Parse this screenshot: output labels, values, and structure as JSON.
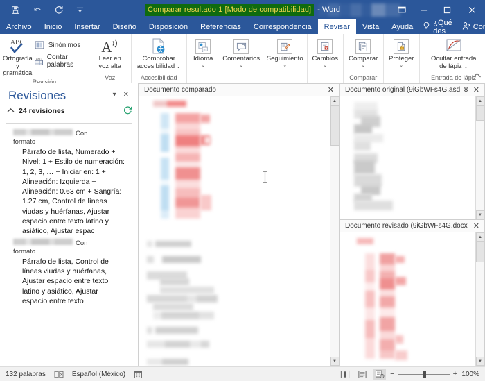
{
  "titlebar": {
    "quick_access": [
      {
        "name": "save-icon",
        "label": "Guardar"
      },
      {
        "name": "undo-icon",
        "label": "Deshacer"
      },
      {
        "name": "redo-icon",
        "label": "Rehacer"
      },
      {
        "name": "customize-qat-icon",
        "label": "Personalizar barra de herramientas de acceso rápido"
      }
    ],
    "doc_title_highlight": "Comparar resultado 1 [Modo de compatibilidad]",
    "doc_title_rest": "- Word",
    "window_controls": [
      {
        "name": "ribbon-display-options-icon",
        "glyph": "⊞"
      },
      {
        "name": "minimize-button",
        "glyph": "—"
      },
      {
        "name": "restore-button",
        "glyph": "❐"
      },
      {
        "name": "close-button",
        "glyph": "✕"
      }
    ]
  },
  "ribbon_tabs": {
    "tabs": [
      {
        "label": "Archivo",
        "active": false
      },
      {
        "label": "Inicio",
        "active": false
      },
      {
        "label": "Insertar",
        "active": false
      },
      {
        "label": "Diseño",
        "active": false
      },
      {
        "label": "Disposición",
        "active": false
      },
      {
        "label": "Referencias",
        "active": false
      },
      {
        "label": "Correspondencia",
        "active": false
      },
      {
        "label": "Revisar",
        "active": true
      },
      {
        "label": "Vista",
        "active": false
      },
      {
        "label": "Ayuda",
        "active": false
      }
    ],
    "tell_me": "¿Qué des",
    "share": "Compartir"
  },
  "ribbon": {
    "groups": [
      {
        "label": "Revisión",
        "big": [
          {
            "label_line1": "Ortografía",
            "label_line2": "y gramática",
            "icon": "spelling-abc-check-icon"
          }
        ],
        "small": [
          {
            "label": "Sinónimos",
            "icon": "thesaurus-icon"
          },
          {
            "label": "Contar palabras",
            "icon": "word-count-icon"
          }
        ]
      },
      {
        "label": "Voz",
        "big": [
          {
            "label_line1": "Leer en",
            "label_line2": "voz alta",
            "icon": "read-aloud-icon"
          }
        ],
        "small": []
      },
      {
        "label": "Accesibilidad",
        "big": [
          {
            "label_line1": "Comprobar",
            "label_line2": "accesibilidad",
            "icon": "check-accessibility-icon",
            "dropdown": true
          }
        ],
        "small": []
      },
      {
        "label": "",
        "big": [
          {
            "label_line1": "Idioma",
            "label_line2": "",
            "icon": "language-icon",
            "dropdown": true
          }
        ],
        "small": []
      },
      {
        "label": "",
        "big": [
          {
            "label_line1": "Comentarios",
            "label_line2": "",
            "icon": "comments-icon",
            "dropdown": true
          }
        ],
        "small": []
      },
      {
        "label": "",
        "big": [
          {
            "label_line1": "Seguimiento",
            "label_line2": "",
            "icon": "track-changes-icon",
            "dropdown": true
          }
        ],
        "small": []
      },
      {
        "label": "",
        "big": [
          {
            "label_line1": "Cambios",
            "label_line2": "",
            "icon": "changes-icon",
            "dropdown": true
          }
        ],
        "small": []
      },
      {
        "label": "Comparar",
        "big": [
          {
            "label_line1": "Comparar",
            "label_line2": "",
            "icon": "compare-icon",
            "dropdown": true
          }
        ],
        "small": []
      },
      {
        "label": "",
        "big": [
          {
            "label_line1": "Proteger",
            "label_line2": "",
            "icon": "protect-icon",
            "dropdown": true
          }
        ],
        "small": []
      },
      {
        "label": "Entrada de lápiz",
        "big": [
          {
            "label_line1": "Ocultar entrada",
            "label_line2": "de lápiz",
            "icon": "hide-ink-icon",
            "dropdown": true
          }
        ],
        "small": []
      }
    ],
    "collapse_label": "^"
  },
  "revisions_pane": {
    "title": "Revisiones",
    "count_label": "24 revisiones",
    "entries": [
      {
        "tag": "Con",
        "tag2": "formato",
        "body": "Párrafo de lista, Numerado + Nivel: 1 + Estilo de numeración: 1, 2, 3, … + Iniciar en: 1 + Alineación: Izquierda + Alineación:  0.63 cm + Sangría:  1.27 cm, Control de líneas viudas y huérfanas, Ajustar espacio entre texto latino y asiático, Ajustar espac"
      },
      {
        "tag": "Con",
        "tag2": "formato",
        "body": "Párrafo de lista, Control de líneas viudas y huérfanas, Ajustar espacio entre texto latino y asiático, Ajustar espacio entre texto"
      }
    ]
  },
  "panes": {
    "compared": {
      "title": "Documento comparado",
      "close": "✕"
    },
    "original": {
      "title": "Documento original (9iGbWFs4G.asd: 8",
      "close": "✕"
    },
    "revised": {
      "title": "Documento revisado (9iGbWFs4G.docx",
      "close": "✕"
    }
  },
  "statusbar": {
    "word_count": "132 palabras",
    "proofing_icon": "proofing-errors-icon",
    "language": "Español (México)",
    "accessibility_icon": "accessibility-icon",
    "right_icons": [
      {
        "name": "focus-mode-icon",
        "glyph": "▯"
      },
      {
        "name": "read-mode-icon",
        "glyph": "▤"
      },
      {
        "name": "print-layout-icon",
        "glyph": "▥",
        "selected": true
      }
    ],
    "zoom_minus": "−",
    "zoom_plus": "+",
    "zoom_value": "100%"
  },
  "colors": {
    "word_blue": "#2b579a",
    "title_highlight_bg": "#0f6b0f",
    "title_highlight_fg": "#f0d44a",
    "accent_green": "#1e9e6a",
    "insert_red": "#f4a0a0",
    "delete_blue": "#b9d8ee"
  }
}
